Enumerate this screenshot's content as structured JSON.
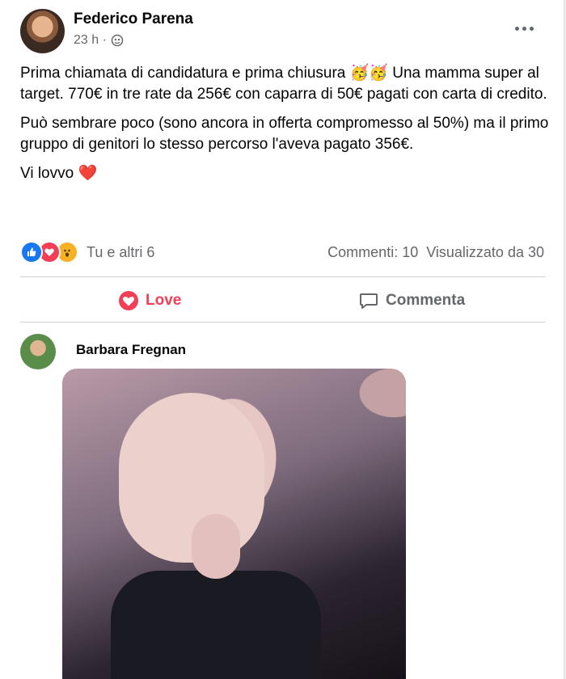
{
  "post": {
    "author": "Federico Parena",
    "time": "23 h ·",
    "paragraphs": [
      "Prima chiamata di candidatura e prima chiusura 🥳🥳 Una mamma super al target. 770€ in tre rate da 256€ con caparra di 50€ pagati con carta di credito.",
      "Può sembrare poco (sono ancora in offerta compromesso al 50%) ma il primo gruppo di genitori lo stesso percorso l'aveva pagato 356€.",
      "Vi lovvo ❤️"
    ],
    "reactions_text": "Tu e altri 6",
    "comments_count": "Commenti: 10",
    "views_count": "Visualizzato da 30",
    "icons": [
      "like-icon",
      "love-icon",
      "wow-icon",
      "globe-icon",
      "more-options-icon"
    ]
  },
  "actions": {
    "love_label": "Love",
    "comment_label": "Commenta"
  },
  "comment": {
    "author": "Barbara Fregnan"
  },
  "colors": {
    "love": "#f33e58",
    "like": "#1877f2",
    "wow": "#f7b125",
    "secondary_text": "#65676b"
  }
}
